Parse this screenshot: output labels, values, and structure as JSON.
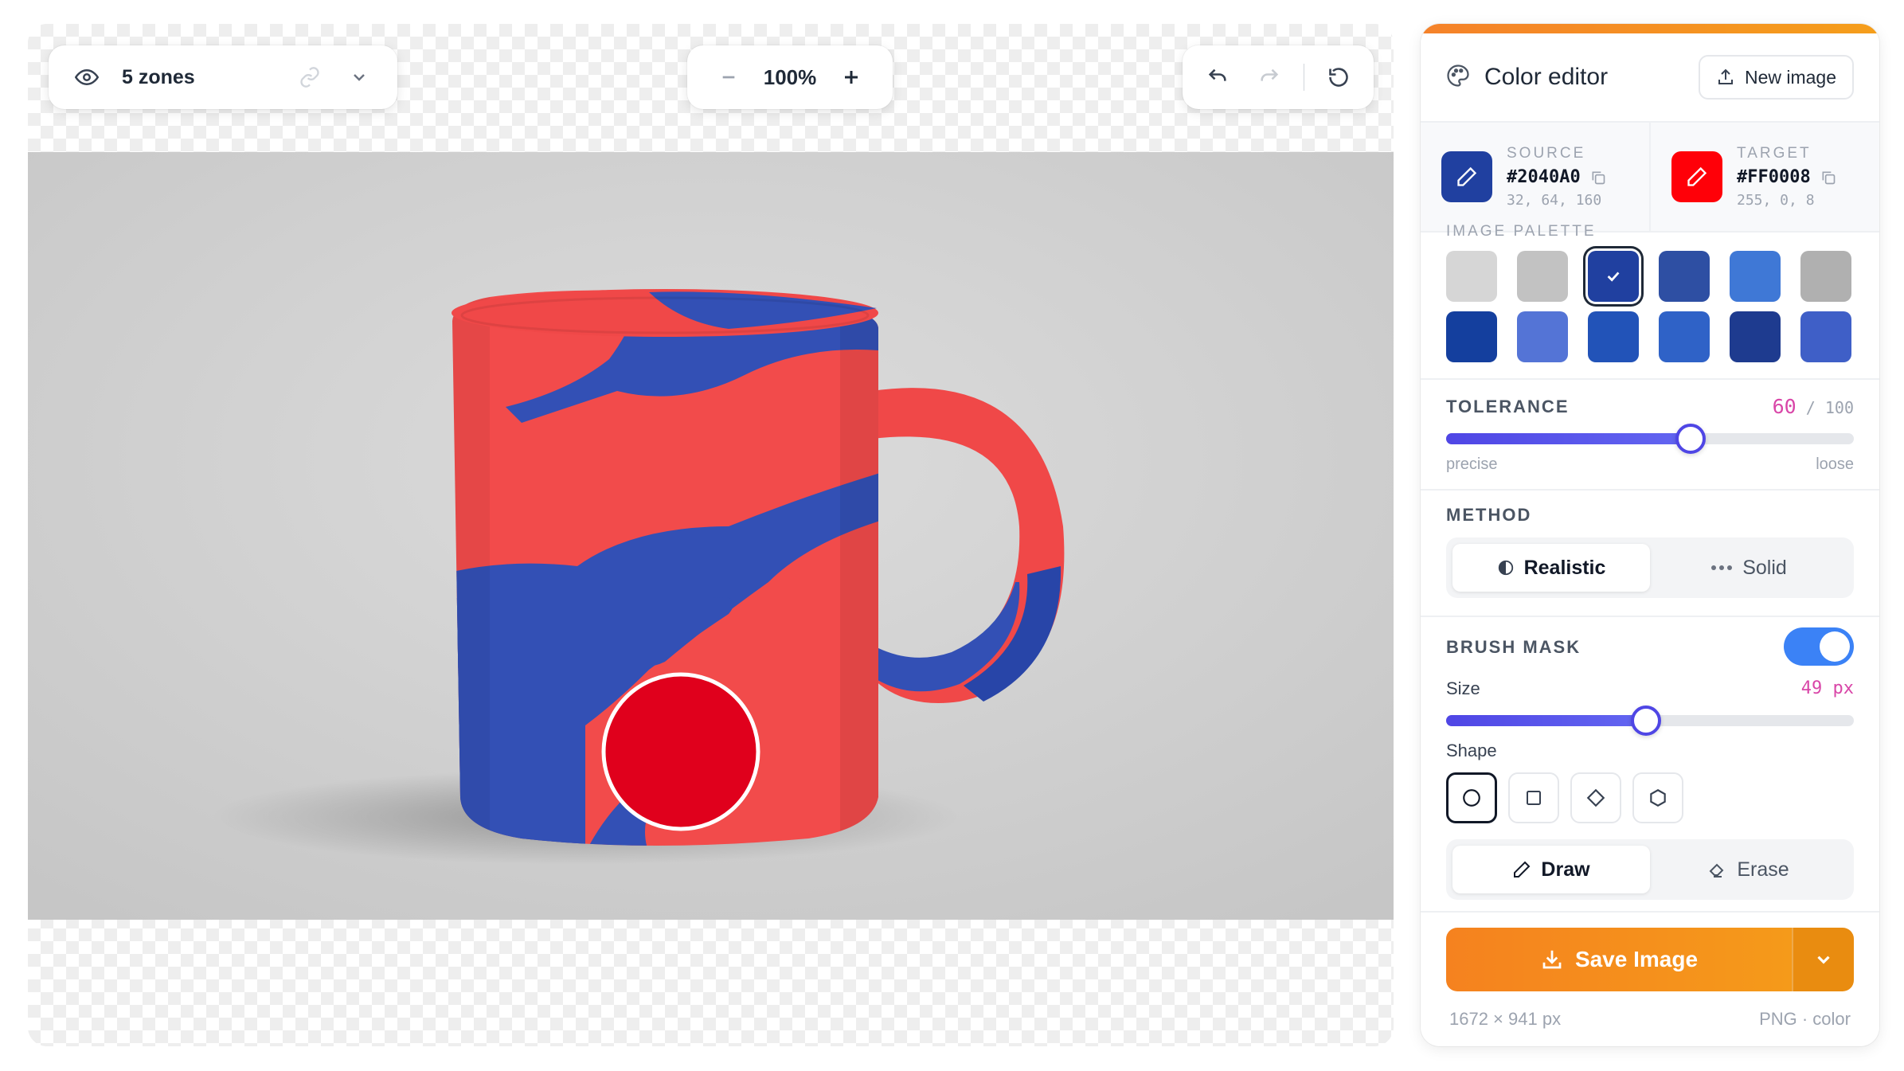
{
  "canvas": {
    "zones_label": "5 zones",
    "zoom": "100%",
    "image_alt": "Mug recolored red and blue"
  },
  "panel": {
    "title": "Color editor",
    "new_image_label": "New image",
    "source": {
      "caption": "SOURCE",
      "hex": "#2040A0",
      "rgb": "32, 64, 160",
      "color": "#2040A0"
    },
    "target": {
      "caption": "TARGET",
      "hex": "#FF0008",
      "rgb": "255, 0, 8",
      "color": "#FF0008"
    },
    "palette_label": "IMAGE PALETTE",
    "palette": [
      "#D6D6D6",
      "#C2C2C2",
      "#2040A0",
      "#2E4FA3",
      "#3F78D6",
      "#B0B0B0",
      "#143F9E",
      "#5474D6",
      "#2253B8",
      "#2F62C7",
      "#1E3B8F",
      "#3F5FC7"
    ],
    "palette_selected_index": 2,
    "tolerance": {
      "label": "TOLERANCE",
      "value": "60",
      "max": "/ 100",
      "fraction": 0.6,
      "min_hint": "precise",
      "max_hint": "loose"
    },
    "method": {
      "label": "METHOD",
      "options": [
        "Realistic",
        "Solid"
      ],
      "active": "Realistic"
    },
    "brush_mask": {
      "label": "BRUSH MASK",
      "enabled": true,
      "size_label": "Size",
      "size_value": "49",
      "size_unit": "px",
      "size_fraction": 0.49,
      "shape_label": "Shape",
      "shapes": [
        "circle",
        "square",
        "diamond",
        "hexagon"
      ],
      "active_shape": "circle",
      "modes": [
        "Draw",
        "Erase"
      ],
      "active_mode": "Draw"
    },
    "save_label": "Save Image",
    "footer_dims": "1672 × 941 px",
    "footer_format": "PNG · color"
  },
  "colors": {
    "accent": "#F5822A",
    "slider": "#4F46E5",
    "toggle": "#3B82F6",
    "value": "#D946A8"
  }
}
